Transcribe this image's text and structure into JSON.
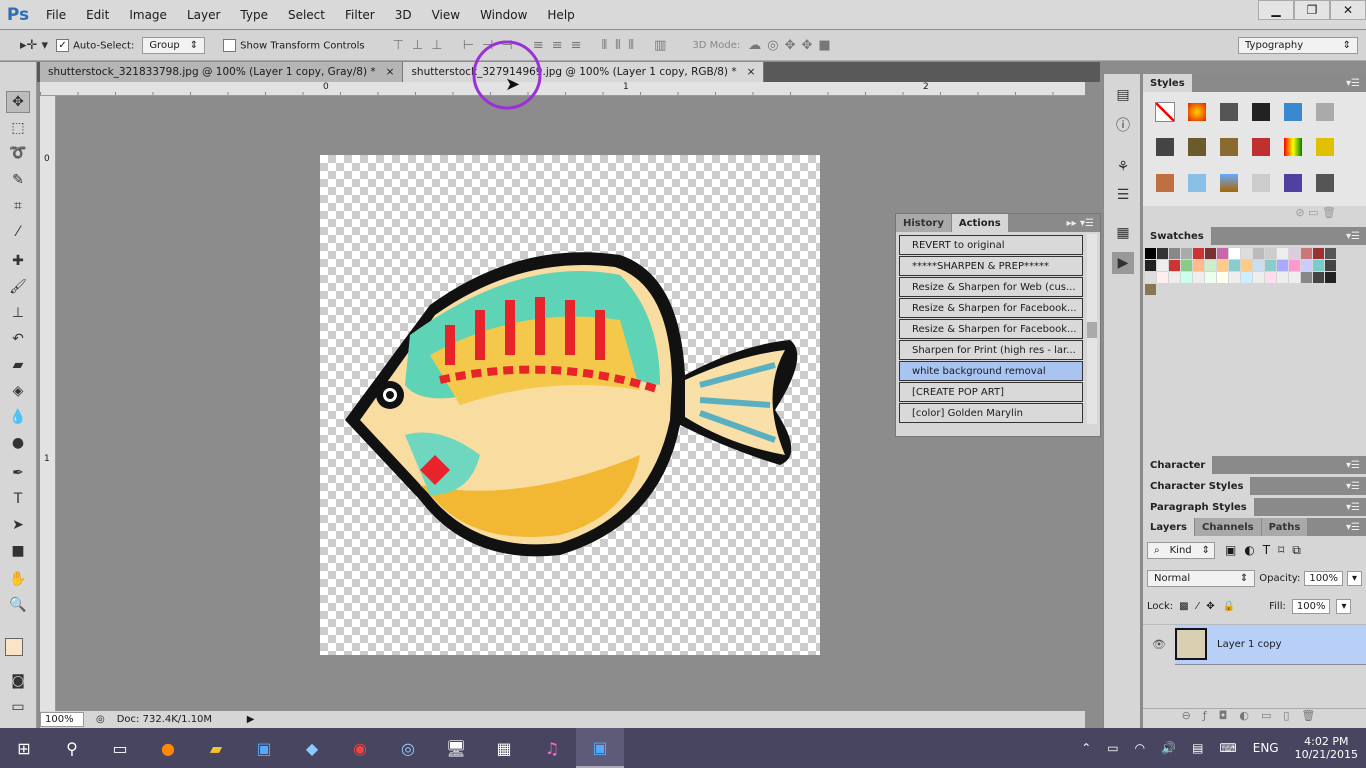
{
  "app": {
    "logo": "Ps"
  },
  "menu": [
    "File",
    "Edit",
    "Image",
    "Layer",
    "Type",
    "Select",
    "Filter",
    "3D",
    "View",
    "Window",
    "Help"
  ],
  "window_controls": [
    "minimize",
    "restore",
    "close"
  ],
  "options": {
    "auto_select_label": "Auto-Select:",
    "auto_select_checked": true,
    "group_value": "Group",
    "show_transform_label": "Show Transform Controls",
    "show_transform_checked": false,
    "mode3d_label": "3D Mode:",
    "workspace": "Typography"
  },
  "tabs": [
    {
      "label": "shutterstock_321833798.jpg @ 100% (Layer 1 copy, Gray/8) *",
      "active": false
    },
    {
      "label": "shutterstock_327914969.jpg @ 100% (Layer 1 copy, RGB/8) *",
      "active": true
    }
  ],
  "ruler": {
    "h": [
      "0",
      "1",
      "2"
    ],
    "v": [
      "0",
      "1"
    ]
  },
  "status": {
    "zoom": "100%",
    "doc": "Doc: 732.4K/1.10M"
  },
  "styles_panel": {
    "title": "Styles"
  },
  "swatches_panel": {
    "title": "Swatches"
  },
  "actions_panel": {
    "tabs": [
      "History",
      "Actions"
    ],
    "items": [
      {
        "label": "REVERT to original",
        "selected": false
      },
      {
        "label": "*****SHARPEN & PREP*****",
        "selected": false
      },
      {
        "label": "Resize & Sharpen for Web (cus...",
        "selected": false
      },
      {
        "label": "Resize & Sharpen for Facebook...",
        "selected": false
      },
      {
        "label": "Resize & Sharpen for Facebook...",
        "selected": false
      },
      {
        "label": "Sharpen for Print (high res - lar...",
        "selected": false
      },
      {
        "label": "white background removal",
        "selected": true
      },
      {
        "label": "[CREATE POP ART]",
        "selected": false
      },
      {
        "label": "[color] Golden Marylin",
        "selected": false
      }
    ]
  },
  "collapsed_panels": [
    "Character",
    "Character Styles",
    "Paragraph Styles"
  ],
  "layers_panel": {
    "tabs": [
      "Layers",
      "Channels",
      "Paths"
    ],
    "filter": "Kind",
    "blend_mode": "Normal",
    "opacity_label": "Opacity:",
    "opacity": "100%",
    "lock_label": "Lock:",
    "fill_label": "Fill:",
    "fill": "100%",
    "layers": [
      {
        "name": "Layer 1 copy",
        "visible": true,
        "selected": true
      }
    ]
  },
  "taskbar": {
    "lang": "ENG",
    "time": "4:02 PM",
    "date": "10/21/2015"
  },
  "colors": {
    "accent": "#aac4f2",
    "taskbar": "#47455f",
    "ps_blue": "#2f6fb8",
    "cursor_highlight": "#9b30d9"
  }
}
